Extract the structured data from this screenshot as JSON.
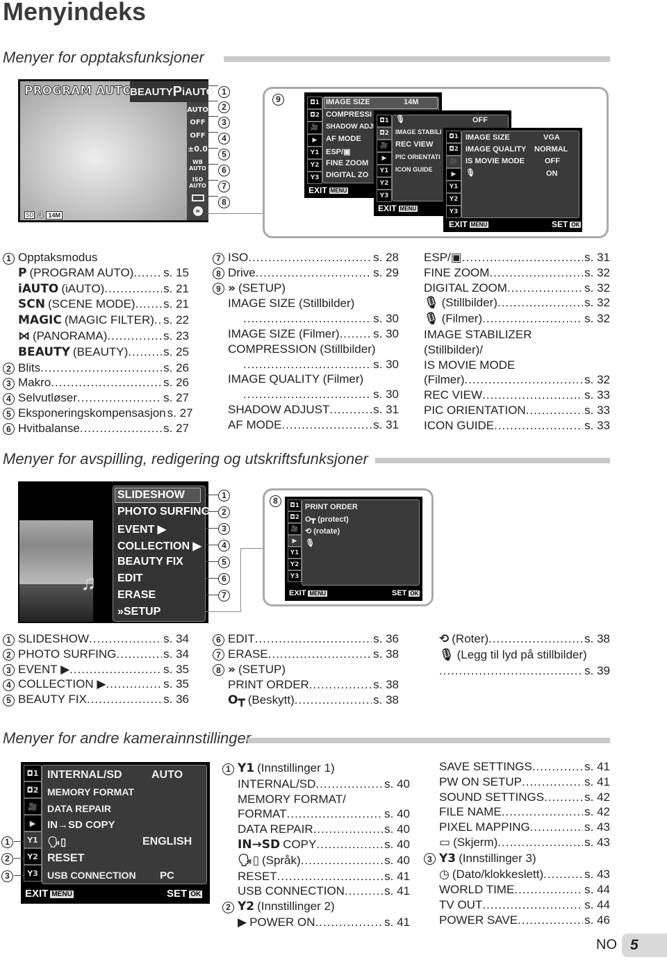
{
  "page_title": "Menyindeks",
  "sections": {
    "shooting": {
      "title": "Menyer for opptaksfunksjoner",
      "lcd": {
        "mode_label": "PROGRAM AUTO",
        "mode_tabs": [
          "BEAUTY",
          "P",
          "iAUTO"
        ],
        "side_icons": [
          {
            "icon": "flash-icon",
            "label": "AUTO"
          },
          {
            "icon": "macro-icon",
            "label": "OFF"
          },
          {
            "icon": "self-timer-icon",
            "label": "OFF"
          },
          {
            "icon": "exposure-icon",
            "label": "±0.0"
          },
          {
            "icon": "wb-icon",
            "label": "WB AUTO"
          },
          {
            "icon": "iso-icon",
            "label": "ISO AUTO"
          },
          {
            "icon": "drive-icon",
            "label": ""
          },
          {
            "icon": "setup-icon",
            "label": "»"
          }
        ],
        "bottom": {
          "card": "SD",
          "shots": "4",
          "size": "14M"
        },
        "callouts": [
          "1",
          "2",
          "3",
          "4",
          "5",
          "6",
          "7",
          "8"
        ]
      },
      "setup_callout": "9",
      "menu1": {
        "items": [
          {
            "label": "IMAGE SIZE",
            "value": "14M"
          },
          {
            "label": "COMPRESSI",
            "value": ""
          },
          {
            "label": "SHADOW ADJU",
            "value": ""
          },
          {
            "label": "AF MODE",
            "value": ""
          },
          {
            "label": "ESP/▣",
            "value": ""
          },
          {
            "label": "FINE ZOOM",
            "value": ""
          },
          {
            "label": "DIGITAL ZO",
            "value": ""
          }
        ],
        "exit": "EXIT",
        "menu_key": "MENU"
      },
      "menu2": {
        "items": [
          {
            "label": "🎙",
            "value": "OFF"
          },
          {
            "label": "IMAGE STABILI",
            "value": ""
          },
          {
            "label": "REC VIEW",
            "value": ""
          },
          {
            "label": "PIC ORIENTATI",
            "value": ""
          },
          {
            "label": "ICON GUIDE",
            "value": ""
          }
        ],
        "exit": "EXIT",
        "menu_key": "MENU"
      },
      "menu3": {
        "items": [
          {
            "label": "IMAGE SIZE",
            "value": "VGA"
          },
          {
            "label": "IMAGE QUALITY",
            "value": "NORMAL"
          },
          {
            "label": "IS MOVIE MODE",
            "value": "OFF"
          },
          {
            "label": "🎙",
            "value": "ON"
          }
        ],
        "exit": "EXIT",
        "menu_key": "MENU",
        "set": "SET",
        "ok_key": "OK"
      },
      "tabs": [
        "◘1",
        "◘2",
        "🎥",
        "▶",
        "Y1",
        "Y2",
        "Y3"
      ],
      "index_col1": [
        {
          "num": "1",
          "label": "Opptaksmodus",
          "page": ""
        },
        {
          "icon": "P",
          "label": "(PROGRAM AUTO)",
          "page": "s. 15"
        },
        {
          "icon": "iAUTO",
          "label": "(iAUTO)",
          "page": "s. 21"
        },
        {
          "icon": "SCN",
          "label": "(SCENE MODE)",
          "page": "s. 21"
        },
        {
          "icon": "MAGIC",
          "label": "(MAGIC FILTER)",
          "page": "s. 22"
        },
        {
          "icon": "⋈",
          "label": "(PANORAMA)",
          "page": "s. 23"
        },
        {
          "icon": "BEAUTY",
          "label": "(BEAUTY)",
          "page": "s. 25"
        },
        {
          "num": "2",
          "label": "Blits",
          "page": "s. 26"
        },
        {
          "num": "3",
          "label": "Makro",
          "page": "s. 26"
        },
        {
          "num": "4",
          "label": "Selvutløser",
          "page": "s. 27"
        },
        {
          "num": "5",
          "label": "Eksponeringskompensasjon",
          "page": "s. 27"
        },
        {
          "num": "6",
          "label": "Hvitbalanse",
          "page": "s. 27"
        }
      ],
      "index_col2": [
        {
          "num": "7",
          "label": "ISO",
          "page": "s. 28"
        },
        {
          "num": "8",
          "label": "Drive",
          "page": "s. 29"
        },
        {
          "num": "9",
          "icon": "»",
          "label": "(SETUP)",
          "page": ""
        },
        {
          "label": "IMAGE SIZE (Stillbilder)",
          "page": ""
        },
        {
          "label": "",
          "page": "s. 30",
          "indent": 2
        },
        {
          "label": "IMAGE SIZE (Filmer)",
          "page": "s. 30"
        },
        {
          "label": "COMPRESSION (Stillbilder)",
          "page": ""
        },
        {
          "label": "",
          "page": "s. 30",
          "indent": 2
        },
        {
          "label": "IMAGE QUALITY (Filmer)",
          "page": ""
        },
        {
          "label": "",
          "page": "s. 30",
          "indent": 2
        },
        {
          "label": "SHADOW ADJUST",
          "page": "s. 31"
        },
        {
          "label": "AF MODE",
          "page": "s. 31"
        }
      ],
      "index_col3": [
        {
          "label": "ESP/▣",
          "page": "s. 31"
        },
        {
          "label": "FINE ZOOM",
          "page": "s. 32"
        },
        {
          "label": "DIGITAL ZOOM",
          "page": "s. 32"
        },
        {
          "icon": "🎙",
          "label": "(Stillbilder)",
          "page": "s. 32"
        },
        {
          "icon": "🎙",
          "label": "(Filmer)",
          "page": "s. 32"
        },
        {
          "label": "IMAGE STABILIZER",
          "page": ""
        },
        {
          "label": "(Stillbilder)/",
          "page": ""
        },
        {
          "label": "IS MOVIE MODE",
          "page": ""
        },
        {
          "label": "(Filmer)",
          "page": "s. 32"
        },
        {
          "label": "REC VIEW",
          "page": "s. 33"
        },
        {
          "label": "PIC ORIENTATION",
          "page": "s. 33"
        },
        {
          "label": "ICON GUIDE",
          "page": "s. 33"
        }
      ]
    },
    "playback": {
      "title": "Menyer for avspilling, redigering og utskriftsfunksjoner",
      "menu_items": [
        "SLIDESHOW",
        "PHOTO SURFING",
        "EVENT ▶",
        "COLLECTION ▶",
        "BEAUTY FIX",
        "EDIT",
        "ERASE",
        "»SETUP"
      ],
      "callouts": [
        "1",
        "2",
        "3",
        "4",
        "5",
        "6",
        "7"
      ],
      "setup_callout": "8",
      "setup_menu": {
        "items": [
          "PRINT ORDER",
          "O┳ (protect)",
          "⟲ (rotate)",
          "🎙"
        ],
        "exit": "EXIT",
        "menu_key": "MENU",
        "set": "SET",
        "ok_key": "OK"
      },
      "index_col1": [
        {
          "num": "1",
          "label": "SLIDESHOW",
          "page": "s. 34"
        },
        {
          "num": "2",
          "label": "PHOTO SURFING",
          "page": "s. 34"
        },
        {
          "num": "3",
          "label": "EVENT ▶",
          "page": "s. 35"
        },
        {
          "num": "4",
          "label": "COLLECTION ▶",
          "page": "s. 35"
        },
        {
          "num": "5",
          "label": "BEAUTY FIX",
          "page": "s. 36"
        }
      ],
      "index_col2": [
        {
          "num": "6",
          "label": "EDIT",
          "page": "s. 36"
        },
        {
          "num": "7",
          "label": "ERASE",
          "page": "s. 38"
        },
        {
          "num": "8",
          "icon": "»",
          "label": "(SETUP)",
          "page": ""
        },
        {
          "label": "PRINT ORDER",
          "page": "s. 38"
        },
        {
          "icon": "O┳",
          "label": "(Beskytt)",
          "page": "s. 38"
        }
      ],
      "index_col3": [
        {
          "icon": "⟲",
          "label": "(Roter)",
          "page": "s. 38"
        },
        {
          "icon": "🎙",
          "label": "(Legg til lyd på stillbilder)",
          "page": ""
        },
        {
          "label": "",
          "page": "s. 39"
        }
      ]
    },
    "settings": {
      "title": "Menyer for andre kamerainnstillinger",
      "menu": {
        "items": [
          {
            "label": "INTERNAL/SD",
            "value": "AUTO"
          },
          {
            "label": "MEMORY FORMAT",
            "value": ""
          },
          {
            "label": "DATA REPAIR",
            "value": ""
          },
          {
            "label": "IN→SD COPY",
            "value": ""
          },
          {
            "label": "🗣▯",
            "value": "ENGLISH"
          },
          {
            "label": "RESET",
            "value": ""
          },
          {
            "label": "USB CONNECTION",
            "value": "PC"
          }
        ],
        "exit": "EXIT",
        "menu_key": "MENU",
        "set": "SET",
        "ok_key": "OK"
      },
      "callouts": [
        "1",
        "2",
        "3"
      ],
      "index_col1": [
        {
          "num": "1",
          "icon": "Y1",
          "label": "(Innstillinger 1)",
          "page": ""
        },
        {
          "label": "INTERNAL/SD",
          "page": "s. 40"
        },
        {
          "label": "MEMORY FORMAT/",
          "page": ""
        },
        {
          "label": "FORMAT",
          "page": "s. 40"
        },
        {
          "label": "DATA REPAIR",
          "page": "s. 40"
        },
        {
          "icon": "IN→SD",
          "label": "COPY",
          "page": "s. 40"
        },
        {
          "icon": "🗣▯",
          "label": "(Språk)",
          "page": "s. 40"
        },
        {
          "label": "RESET",
          "page": "s. 41"
        },
        {
          "label": "USB CONNECTION",
          "page": "s. 41"
        },
        {
          "num": "2",
          "icon": "Y2",
          "label": "(Innstillinger 2)",
          "page": ""
        },
        {
          "icon": "▶",
          "label": "POWER ON",
          "page": "s. 41"
        }
      ],
      "index_col2": [
        {
          "label": "SAVE SETTINGS",
          "page": "s. 41"
        },
        {
          "label": "PW ON SETUP",
          "page": "s. 41"
        },
        {
          "label": "SOUND SETTINGS",
          "page": "s. 42"
        },
        {
          "label": "FILE NAME",
          "page": "s. 42"
        },
        {
          "label": "PIXEL MAPPING",
          "page": "s. 43"
        },
        {
          "icon": "▭",
          "label": "(Skjerm)",
          "page": "s. 43"
        },
        {
          "num": "3",
          "icon": "Y3",
          "label": "(Innstillinger 3)",
          "page": ""
        },
        {
          "icon": "◷",
          "label": "(Dato/klokkeslett)",
          "page": "s. 43"
        },
        {
          "label": "WORLD TIME",
          "page": "s. 44"
        },
        {
          "label": "TV OUT",
          "page": "s. 44"
        },
        {
          "label": "POWER SAVE",
          "page": "s. 46"
        }
      ]
    }
  },
  "footer": {
    "lang": "NO",
    "page": "5"
  }
}
